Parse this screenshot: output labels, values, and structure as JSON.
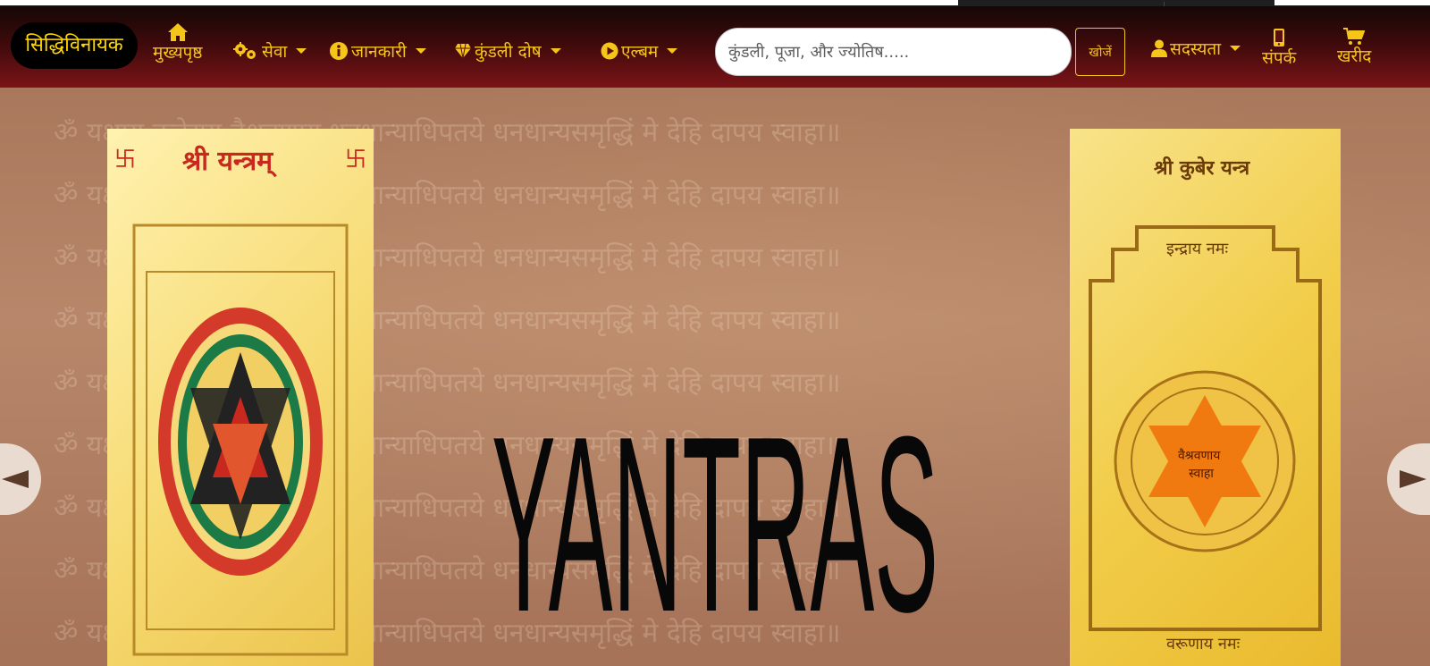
{
  "brand": {
    "name": "सिद्धिविनायक"
  },
  "nav": {
    "home": "मुख्यपृष्ठ",
    "seva": "सेवा",
    "jankari": "जानकारी",
    "kundali_dosh": "कुंडली दोष",
    "album": "एल्बम",
    "membership": "सदस्यता",
    "contact": "संपर्क",
    "cart": "खरीद"
  },
  "search": {
    "placeholder": "कुंडली, पूजा, और ज्योतिष.....",
    "button_label": "खोजें"
  },
  "hero": {
    "title": "YANTRAS",
    "left_yantra": {
      "title": "श्री यन्त्रम्"
    },
    "right_yantra": {
      "title": "श्री कुबेर यन्त्र",
      "top_label": "इन्द्राय नमः",
      "bottom_label": "वरूणाय नमः",
      "center_label_1": "वैश्रवणाय",
      "center_label_2": "स्वाहा"
    },
    "watermark_text": "ॐ यक्षाय कुबेराय वैश्रवणाय धनधान्याधिपतये धनधान्यसमृद्धिं मे देहि दापय स्वाहा॥"
  },
  "colors": {
    "accent": "#f5c518",
    "navbar_top": "#160707",
    "navbar_bottom": "#7a1417",
    "brand_bg": "#000000"
  },
  "icons": {
    "home": "home-icon",
    "seva": "gears-icon",
    "jankari": "info-icon",
    "kundali": "gem-icon",
    "album": "play-circle-icon",
    "membership": "user-icon",
    "contact": "mobile-icon",
    "cart": "cart-icon"
  }
}
